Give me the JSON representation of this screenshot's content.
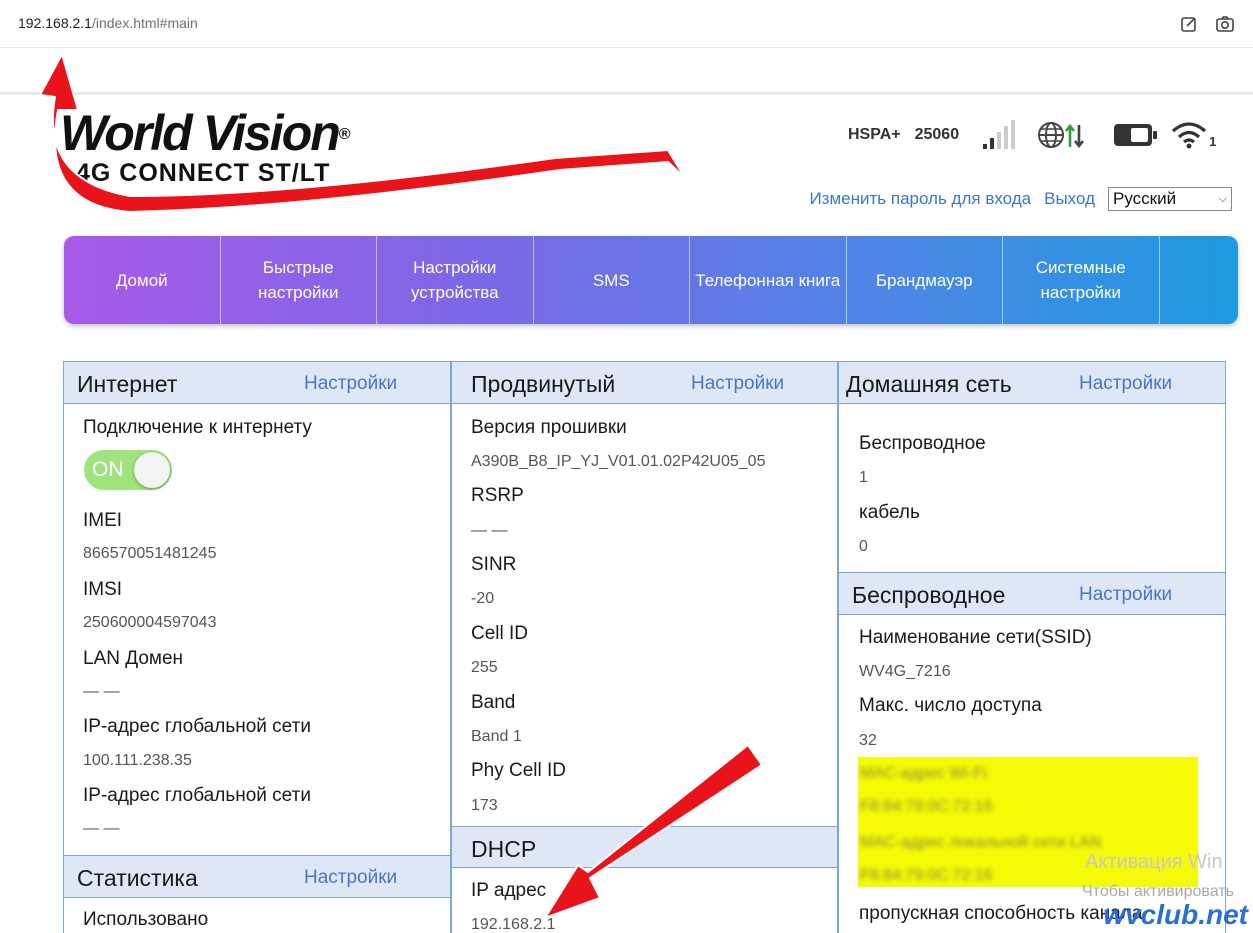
{
  "browser": {
    "url_host": "192.168.2.1",
    "url_path": "/index.html#main"
  },
  "header": {
    "logo_main": "World Vision",
    "logo_sub": "4G CONNECT ST/LT",
    "network_type": "HSPA+",
    "operator_code": "25060",
    "wifi_clients": "1",
    "change_password": "Изменить пароль для входа",
    "logout": "Выход",
    "language": "Русский"
  },
  "nav": [
    {
      "label": "Домой"
    },
    {
      "label": "Быстрые настройки"
    },
    {
      "label": "Настройки устройства"
    },
    {
      "label": "SMS"
    },
    {
      "label": "Телефонная книга"
    },
    {
      "label": "Брандмауэр"
    },
    {
      "label": "Системные настройки"
    }
  ],
  "internet": {
    "title": "Интернет",
    "settings": "Настройки",
    "connection_label": "Подключение к интернету",
    "toggle": "ON",
    "imei_label": "IMEI",
    "imei": "866570051481245",
    "imsi_label": "IMSI",
    "imsi": "250600004597043",
    "lan_domain_label": "LAN Домен",
    "lan_domain": "— —",
    "wan_ip_label": "IP-адрес глобальной сети",
    "wan_ip": "100.111.238.35",
    "wan_ip2_label": "IP-адрес глобальной сети",
    "wan_ip2": "— —"
  },
  "statistics": {
    "title": "Статистика",
    "settings": "Настройки",
    "used_label": "Использовано"
  },
  "advanced": {
    "title": "Продвинутый",
    "settings": "Настройки",
    "firmware_label": "Версия прошивки",
    "firmware": "A390B_B8_IP_YJ_V01.01.02P42U05_05",
    "rsrp_label": "RSRP",
    "rsrp": "— —",
    "sinr_label": "SINR",
    "sinr": "-20",
    "cellid_label": "Cell ID",
    "cellid": "255",
    "band_label": "Band",
    "band": "Band 1",
    "phycell_label": "Phy Cell ID",
    "phycell": "173"
  },
  "dhcp": {
    "title": "DHCP",
    "ip_label": "IP адрес",
    "ip": "192.168.2.1"
  },
  "home_network": {
    "title": "Домашняя сеть",
    "settings": "Настройки",
    "wireless_label": "Беспроводное",
    "wireless": "1",
    "cable_label": "кабель",
    "cable": "0"
  },
  "wireless": {
    "title": "Беспроводное",
    "settings": "Настройки",
    "ssid_label": "Наименование сети(SSID)",
    "ssid": "WV4G_7216",
    "max_access_label": "Макс. число доступа",
    "max_access": "32",
    "wifi_mac_label": "MAC-адрес Wi-Fi",
    "wifi_mac": "F8:84:79:0C:72:16",
    "lan_mac_label": "MAC-адрес локальной сети LAN",
    "lan_mac": "F8:84:79:0C:72:16",
    "bandwidth_label": "пропускная способность канала"
  },
  "overlay": {
    "win_watermark": "Активация Win",
    "win_watermark2": "Чтобы активировать",
    "site": "wvclub.net"
  },
  "colors": {
    "accent_link": "#4a76c6",
    "panel_head": "#dde7f5",
    "panel_border": "#7fa7d4",
    "arrow": "#e8141a",
    "highlight": "#f5fb04"
  }
}
